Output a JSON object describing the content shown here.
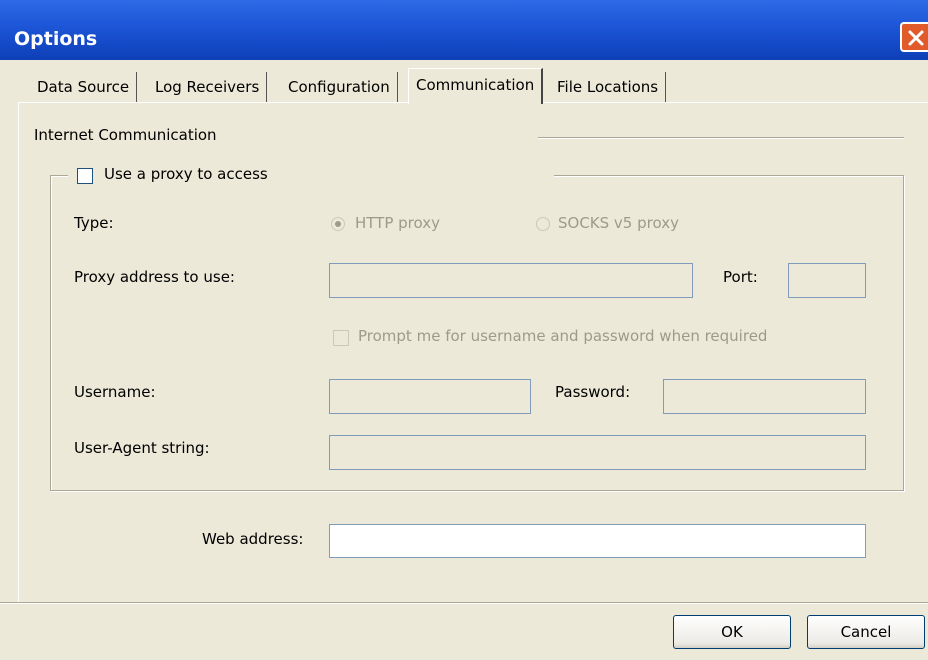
{
  "window": {
    "title": "Options"
  },
  "tabs": [
    {
      "label": "Data Source"
    },
    {
      "label": "Log Receivers"
    },
    {
      "label": "Configuration"
    },
    {
      "label": "Communication"
    },
    {
      "label": "File Locations"
    }
  ],
  "section": {
    "title": "Internet Communication"
  },
  "proxy": {
    "use_proxy_label": "Use a proxy to access",
    "type_label": "Type:",
    "http_label": "HTTP proxy",
    "socks_label": "SOCKS v5 proxy",
    "address_label": "Proxy address to use:",
    "address_value": "",
    "port_label": "Port:",
    "port_value": "",
    "prompt_label": "Prompt me for username and password when required",
    "username_label": "Username:",
    "username_value": "",
    "password_label": "Password:",
    "password_value": "",
    "user_agent_label": "User-Agent string:",
    "user_agent_value": ""
  },
  "web": {
    "address_label": "Web address:",
    "address_value": ""
  },
  "buttons": {
    "ok": "OK",
    "cancel": "Cancel"
  }
}
